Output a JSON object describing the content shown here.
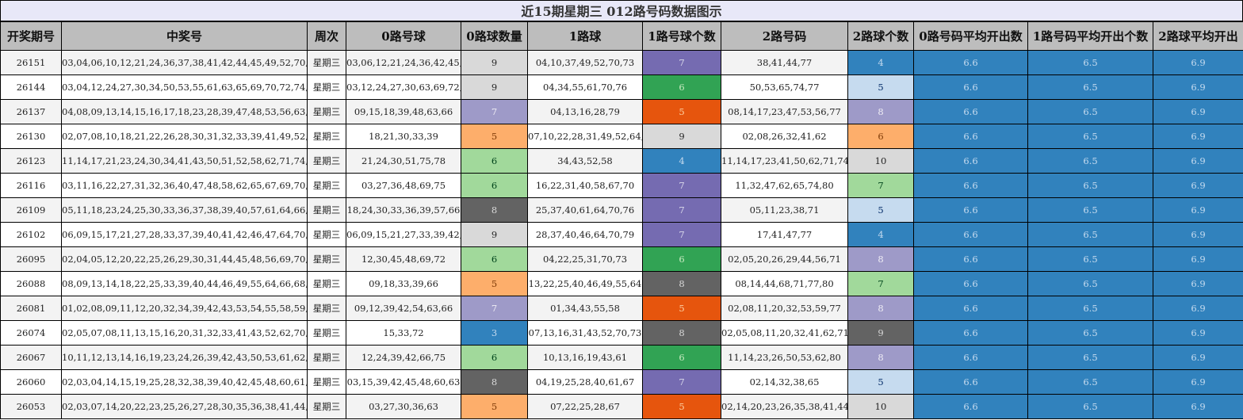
{
  "title": "近15期星期三 012路号码数据图示",
  "headers": [
    "开奖期号",
    "中奖号",
    "周次",
    "0路号球",
    "0路球数量",
    "1路球",
    "1路号球个数",
    "2路号码",
    "2路球个数",
    "0路号码平均开出数",
    "1路号码平均开出个数",
    "2路球平均开出"
  ],
  "palette": {
    "3": {
      "bg": "#3182bd",
      "fg": "#c6dbef"
    },
    "4": {
      "bg": "#3182bd",
      "fg": "#c6dbef"
    },
    "5a": {
      "bg": "#fdae6b",
      "fg": "#7f3b08"
    },
    "5b": {
      "bg": "#e6550d",
      "fg": "#fdd0a2"
    },
    "5c": {
      "bg": "#c6dbef",
      "fg": "#08306b"
    },
    "6a": {
      "bg": "#a1d99b",
      "fg": "#00441b"
    },
    "6b": {
      "bg": "#31a354",
      "fg": "#c7e9c0"
    },
    "7a": {
      "bg": "#9e9ac8",
      "fg": "#efedf5"
    },
    "7b": {
      "bg": "#756bb1",
      "fg": "#dadaeb"
    },
    "7c": {
      "bg": "#a1d99b",
      "fg": "#00441b"
    },
    "8a": {
      "bg": "#636363",
      "fg": "#d9d9d9"
    },
    "8b": {
      "bg": "#9e9ac8",
      "fg": "#efedf5"
    },
    "9a": {
      "bg": "#d9d9d9",
      "fg": "#252525"
    },
    "9b": {
      "bg": "#636363",
      "fg": "#d9d9d9"
    },
    "10": {
      "bg": "#d9d9d9",
      "fg": "#252525"
    },
    "avg": {
      "bg": "#3182bd",
      "fg": "#c6dbef"
    }
  },
  "rows": [
    {
      "issue": "26151",
      "numbers": "03,04,06,10,12,21,24,36,37,38,41,42,44,45,49,52,70,73,77,78",
      "week": "星期三",
      "r0": "03,06,12,21,24,36,42,45,78",
      "c0": {
        "v": "9",
        "s": "9a"
      },
      "r1": "04,10,37,49,52,70,73",
      "c1": {
        "v": "7",
        "s": "7b"
      },
      "r2": "38,41,44,77",
      "c2": {
        "v": "4",
        "s": "4"
      },
      "a0": "6.6",
      "a1": "6.5",
      "a2": "6.9"
    },
    {
      "issue": "26144",
      "numbers": "03,04,12,24,27,30,34,50,53,55,61,63,65,69,70,72,74,75,76,77",
      "week": "星期三",
      "r0": "03,12,24,27,30,63,69,72,75",
      "c0": {
        "v": "9",
        "s": "9a"
      },
      "r1": "04,34,55,61,70,76",
      "c1": {
        "v": "6",
        "s": "6b"
      },
      "r2": "50,53,65,74,77",
      "c2": {
        "v": "5",
        "s": "5c"
      },
      "a0": "6.6",
      "a1": "6.5",
      "a2": "6.9"
    },
    {
      "issue": "26137",
      "numbers": "04,08,09,13,14,15,16,17,18,23,28,39,47,48,53,56,63,66,77,79",
      "week": "星期三",
      "r0": "09,15,18,39,48,63,66",
      "c0": {
        "v": "7",
        "s": "7a"
      },
      "r1": "04,13,16,28,79",
      "c1": {
        "v": "5",
        "s": "5b"
      },
      "r2": "08,14,17,23,47,53,56,77",
      "c2": {
        "v": "8",
        "s": "8b"
      },
      "a0": "6.6",
      "a1": "6.5",
      "a2": "6.9"
    },
    {
      "issue": "26130",
      "numbers": "02,07,08,10,18,21,22,26,28,30,31,32,33,39,41,49,52,62,64,67",
      "week": "星期三",
      "r0": "18,21,30,33,39",
      "c0": {
        "v": "5",
        "s": "5a"
      },
      "r1": "07,10,22,28,31,49,52,64,67",
      "c1": {
        "v": "9",
        "s": "9a"
      },
      "r2": "02,08,26,32,41,62",
      "c2": {
        "v": "6",
        "s": "5a"
      },
      "a0": "6.6",
      "a1": "6.5",
      "a2": "6.9"
    },
    {
      "issue": "26123",
      "numbers": "11,14,17,21,23,24,30,34,41,43,50,51,52,58,62,71,74,75,78,80",
      "week": "星期三",
      "r0": "21,24,30,51,75,78",
      "c0": {
        "v": "6",
        "s": "6a"
      },
      "r1": "34,43,52,58",
      "c1": {
        "v": "4",
        "s": "4"
      },
      "r2": "11,14,17,23,41,50,62,71,74,80",
      "c2": {
        "v": "10",
        "s": "10"
      },
      "a0": "6.6",
      "a1": "6.5",
      "a2": "6.9"
    },
    {
      "issue": "26116",
      "numbers": "03,11,16,22,27,31,32,36,40,47,48,58,62,65,67,69,70,74,75,80",
      "week": "星期三",
      "r0": "03,27,36,48,69,75",
      "c0": {
        "v": "6",
        "s": "6a"
      },
      "r1": "16,22,31,40,58,67,70",
      "c1": {
        "v": "7",
        "s": "7b"
      },
      "r2": "11,32,47,62,65,74,80",
      "c2": {
        "v": "7",
        "s": "7c"
      },
      "a0": "6.6",
      "a1": "6.5",
      "a2": "6.9"
    },
    {
      "issue": "26109",
      "numbers": "05,11,18,23,24,25,30,33,36,37,38,39,40,57,61,64,66,70,71,76",
      "week": "星期三",
      "r0": "18,24,30,33,36,39,57,66",
      "c0": {
        "v": "8",
        "s": "8a"
      },
      "r1": "25,37,40,61,64,70,76",
      "c1": {
        "v": "7",
        "s": "7b"
      },
      "r2": "05,11,23,38,71",
      "c2": {
        "v": "5",
        "s": "5c"
      },
      "a0": "6.6",
      "a1": "6.5",
      "a2": "6.9"
    },
    {
      "issue": "26102",
      "numbers": "06,09,15,17,21,27,28,33,37,39,40,41,42,46,47,64,70,77,78,79",
      "week": "星期三",
      "r0": "06,09,15,21,27,33,39,42,78",
      "c0": {
        "v": "9",
        "s": "9a"
      },
      "r1": "28,37,40,46,64,70,79",
      "c1": {
        "v": "7",
        "s": "7b"
      },
      "r2": "17,41,47,77",
      "c2": {
        "v": "4",
        "s": "4"
      },
      "a0": "6.6",
      "a1": "6.5",
      "a2": "6.9"
    },
    {
      "issue": "26095",
      "numbers": "02,04,05,12,20,22,25,26,29,30,31,44,45,48,56,69,70,71,72,73",
      "week": "星期三",
      "r0": "12,30,45,48,69,72",
      "c0": {
        "v": "6",
        "s": "6a"
      },
      "r1": "04,22,25,31,70,73",
      "c1": {
        "v": "6",
        "s": "6b"
      },
      "r2": "02,05,20,26,29,44,56,71",
      "c2": {
        "v": "8",
        "s": "8b"
      },
      "a0": "6.6",
      "a1": "6.5",
      "a2": "6.9"
    },
    {
      "issue": "26088",
      "numbers": "08,09,13,14,18,22,25,33,39,40,44,46,49,55,64,66,68,71,77,80",
      "week": "星期三",
      "r0": "09,18,33,39,66",
      "c0": {
        "v": "5",
        "s": "5a"
      },
      "r1": "13,22,25,40,46,49,55,64",
      "c1": {
        "v": "8",
        "s": "8a"
      },
      "r2": "08,14,44,68,71,77,80",
      "c2": {
        "v": "7",
        "s": "7c"
      },
      "a0": "6.6",
      "a1": "6.5",
      "a2": "6.9"
    },
    {
      "issue": "26081",
      "numbers": "01,02,08,09,11,12,20,32,34,39,42,43,53,54,55,58,59,63,66,77",
      "week": "星期三",
      "r0": "09,12,39,42,54,63,66",
      "c0": {
        "v": "7",
        "s": "7a"
      },
      "r1": "01,34,43,55,58",
      "c1": {
        "v": "5",
        "s": "5b"
      },
      "r2": "02,08,11,20,32,53,59,77",
      "c2": {
        "v": "8",
        "s": "8b"
      },
      "a0": "6.6",
      "a1": "6.5",
      "a2": "6.9"
    },
    {
      "issue": "26074",
      "numbers": "02,05,07,08,11,13,15,16,20,31,32,33,41,43,52,62,70,71,72,73",
      "week": "星期三",
      "r0": "15,33,72",
      "c0": {
        "v": "3",
        "s": "3"
      },
      "r1": "07,13,16,31,43,52,70,73",
      "c1": {
        "v": "8",
        "s": "8a"
      },
      "r2": "02,05,08,11,20,32,41,62,71",
      "c2": {
        "v": "9",
        "s": "9b"
      },
      "a0": "6.6",
      "a1": "6.5",
      "a2": "6.9"
    },
    {
      "issue": "26067",
      "numbers": "10,11,12,13,14,16,19,23,24,26,39,42,43,50,53,61,62,66,75,80",
      "week": "星期三",
      "r0": "12,24,39,42,66,75",
      "c0": {
        "v": "6",
        "s": "6a"
      },
      "r1": "10,13,16,19,43,61",
      "c1": {
        "v": "6",
        "s": "6b"
      },
      "r2": "11,14,23,26,50,53,62,80",
      "c2": {
        "v": "8",
        "s": "8b"
      },
      "a0": "6.6",
      "a1": "6.5",
      "a2": "6.9"
    },
    {
      "issue": "26060",
      "numbers": "02,03,04,14,15,19,25,28,32,38,39,40,42,45,48,60,61,63,65,67",
      "week": "星期三",
      "r0": "03,15,39,42,45,48,60,63",
      "c0": {
        "v": "8",
        "s": "8a"
      },
      "r1": "04,19,25,28,40,61,67",
      "c1": {
        "v": "7",
        "s": "7b"
      },
      "r2": "02,14,32,38,65",
      "c2": {
        "v": "5",
        "s": "5c"
      },
      "a0": "6.6",
      "a1": "6.5",
      "a2": "6.9"
    },
    {
      "issue": "26053",
      "numbers": "02,03,07,14,20,22,23,25,26,27,28,30,35,36,38,41,44,63,67,68",
      "week": "星期三",
      "r0": "03,27,30,36,63",
      "c0": {
        "v": "5",
        "s": "5a"
      },
      "r1": "07,22,25,28,67",
      "c1": {
        "v": "5",
        "s": "5b"
      },
      "r2": "02,14,20,23,26,35,38,41,44,68",
      "c2": {
        "v": "10",
        "s": "10"
      },
      "a0": "6.6",
      "a1": "6.5",
      "a2": "6.9"
    }
  ]
}
